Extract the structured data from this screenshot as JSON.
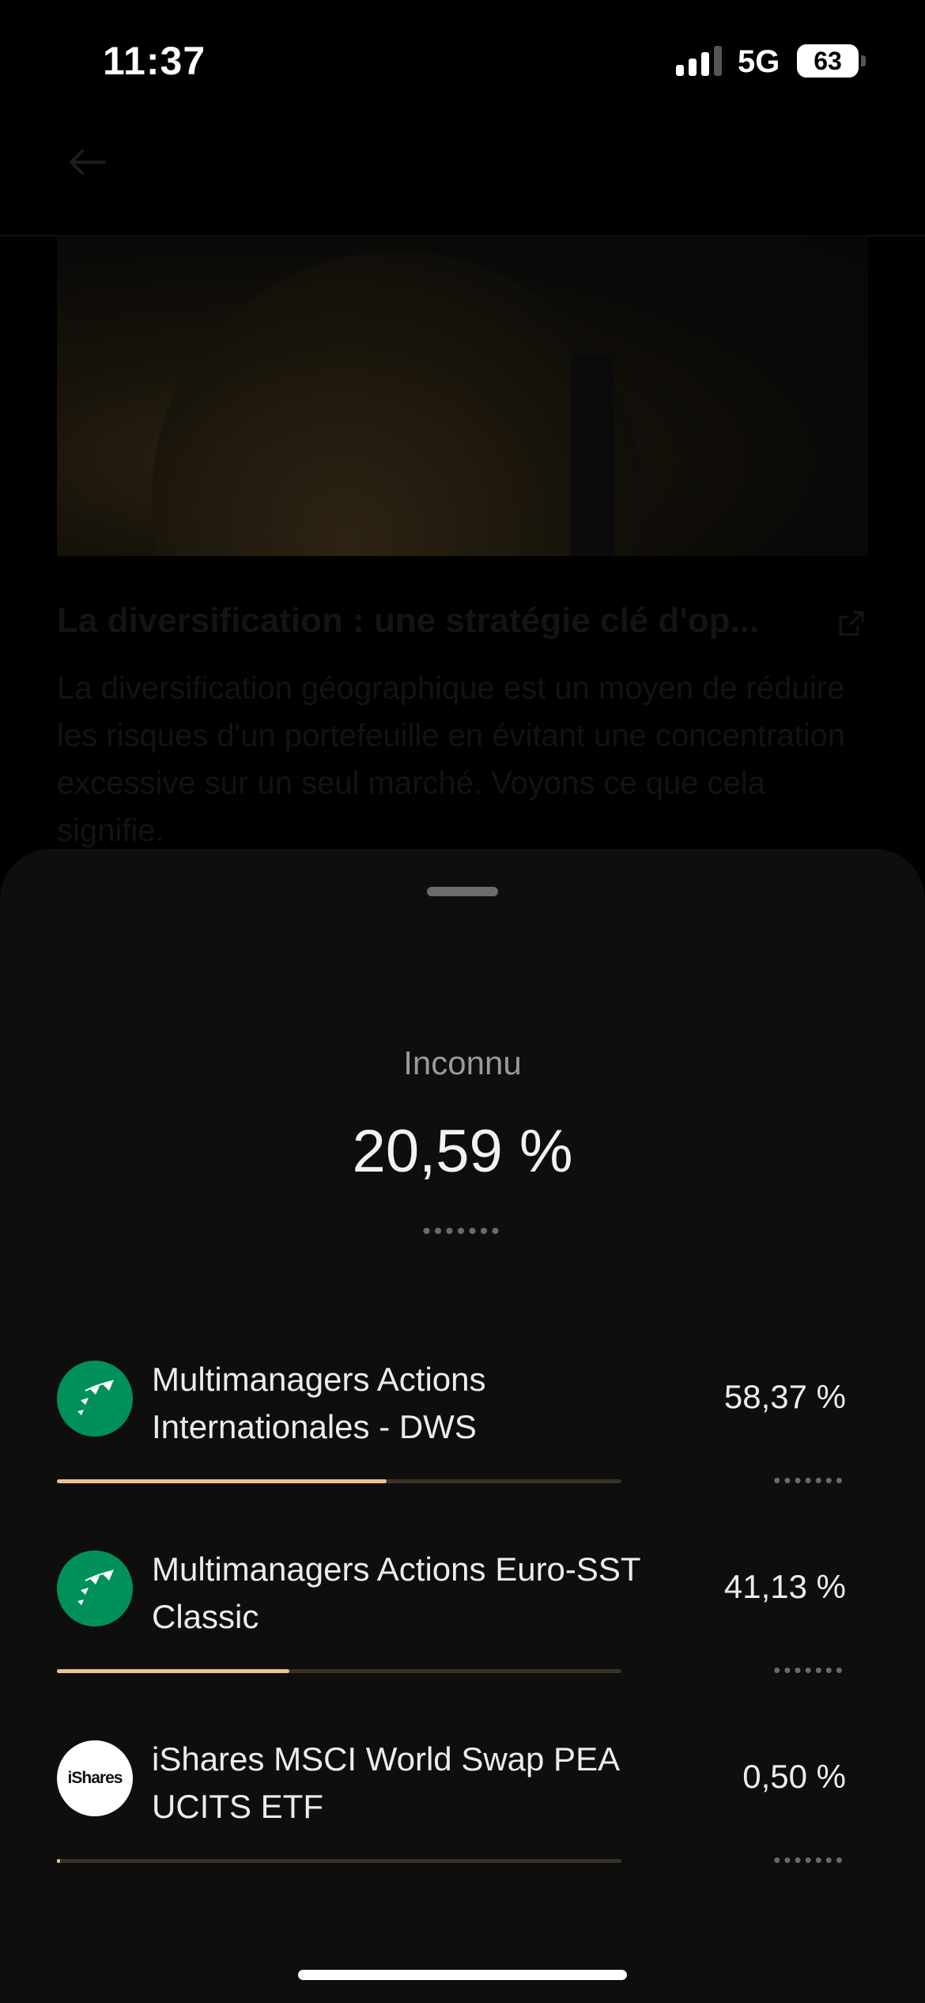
{
  "status_bar": {
    "time": "11:37",
    "network": "5G",
    "battery": "63"
  },
  "article": {
    "title": "La diversification : une stratégie clé d'op...",
    "body": "La diversification géographique est un moyen de réduire les risques d'un portefeuille en évitant une concentration excessive sur un seul marché. Voyons ce que cela signifie."
  },
  "sheet": {
    "country_label": "Inconnu",
    "total_percentage": "20,59 %",
    "hidden_amount": "•••••••",
    "funds": [
      {
        "name": "Multimanagers Actions Internationales - DWS",
        "percentage": "58,37 %",
        "share": 0.5837,
        "hidden_amount": "•••••••",
        "logo": "bnp-paribas-logo"
      },
      {
        "name": "Multimanagers Actions Euro-SST Classic",
        "percentage": "41,13 %",
        "share": 0.4113,
        "hidden_amount": "•••••••",
        "logo": "bnp-paribas-logo"
      },
      {
        "name": "iShares MSCI World Swap PEA UCITS ETF",
        "percentage": "0,50 %",
        "share": 0.005,
        "hidden_amount": "•••••••",
        "logo": "ishares-logo",
        "logo_text": "iShares"
      }
    ]
  },
  "colors": {
    "sheet_background": "#0e0e0e",
    "progress_fill": "#f1c38d",
    "progress_track": "#3a3128",
    "bnp_green": "#00915a"
  }
}
